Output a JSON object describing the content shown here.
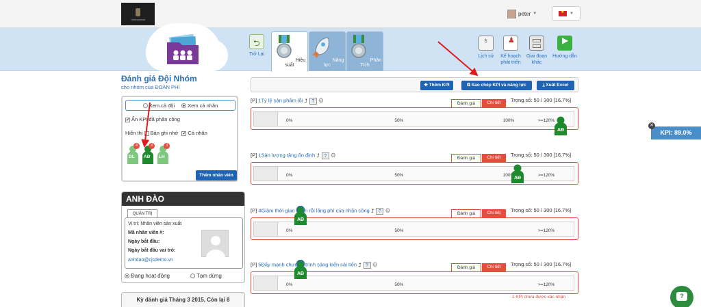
{
  "header": {
    "logo_text": "Vietnamese",
    "username": "peter"
  },
  "nav": {
    "back_label": "Trở Lại",
    "tabs": [
      {
        "label": "Hiệu suất"
      },
      {
        "label": "Năng lực"
      },
      {
        "label": "Phân Tích"
      }
    ],
    "right_items": [
      {
        "label": "Lịch sử"
      },
      {
        "label": "Kế hoạch phát triển"
      },
      {
        "label": "Giai đoạn khác"
      },
      {
        "label": "Hướng dẫn"
      }
    ]
  },
  "sidebar": {
    "title": "Đánh giá Đội Nhóm",
    "subtitle": "cho nhóm của ĐOÀN PHI",
    "view_team": "Xem cả đội",
    "view_individual": "Xem cả nhân",
    "hide_assigned": "Ẩn KPI đã phân công",
    "show_label": "Hiển thị",
    "notes_label": "Bản ghi nhớ",
    "personal_label": "Cá nhân",
    "people": [
      {
        "initials": "DL",
        "badge": "4"
      },
      {
        "initials": "AĐ",
        "badge": "3"
      },
      {
        "initials": "LH",
        "badge": "3"
      }
    ],
    "add_staff": "Thêm nhân viên"
  },
  "profile": {
    "name": "ANH ĐÀO",
    "tab": "QUẢN TRỊ",
    "position": "Vị trí: Nhân viên sản xuất",
    "employee_no": "Mã nhân viên #:",
    "start_date": "Ngày bắt đầu:",
    "role_start": "Ngày bắt đầu vai trò:",
    "email": "anhdao@cjsdemo.vn",
    "active": "Đang hoạt động",
    "paused": "Tạm dừng"
  },
  "period": {
    "text": "Kỳ đánh giá Tháng 3 2015, Còn lại 8"
  },
  "toolbar": {
    "add_kpi": "Thêm KPI",
    "copy_kpi": "Sao chép KPI và năng lực",
    "export_excel": "Xuất Excel"
  },
  "tabs_common": {
    "evaluate": "Đánh giá",
    "detail": "Chi tiết"
  },
  "kpis": [
    {
      "prefix": "[P]",
      "number": "1",
      "title": "Tỷ lệ sản phẩm lỗi",
      "arrow": "⮥",
      "weight": "Trọng số: 50 / 300 [16.7%]",
      "ticks": [
        "0%",
        "50%",
        "100%",
        ">=120%"
      ],
      "achievement": 1.2
    },
    {
      "prefix": "[P]",
      "number": "1",
      "title": "Sản lượng tăng ổn định",
      "arrow": "⮥",
      "weight": "Trọng số: 50 / 300 [16.7%]",
      "ticks": [
        "0%",
        "50%",
        "100%",
        ">=120%"
      ],
      "achievement": 1.0
    },
    {
      "prefix": "[P]",
      "number": "4",
      "title": "Giảm thời gian nhàn rỗi lãng phí của nhân công",
      "arrow": "⮥",
      "weight": "Trọng số: 50 / 300 [16.7%]",
      "ticks": [
        "0%",
        "50%",
        ">=120%"
      ],
      "achievement": 0.0
    },
    {
      "prefix": "[P]",
      "number": "5",
      "title": "Đẩy mạnh chương trình sáng kiến cải tiến",
      "arrow": "⮥",
      "weight": "Trọng số: 50 / 300 [16.7%]",
      "ticks": [
        "0%",
        "50%",
        ">=120%"
      ],
      "achievement": 0.0
    }
  ],
  "unconfirmed": "1 KPI chưa được xác nhận",
  "kpi_total": "KPI: 89.0%",
  "colors": {
    "accent": "#1f63b3",
    "danger": "#e74c3c",
    "band": "#cfe3f4",
    "green": "#2e8b3e"
  }
}
